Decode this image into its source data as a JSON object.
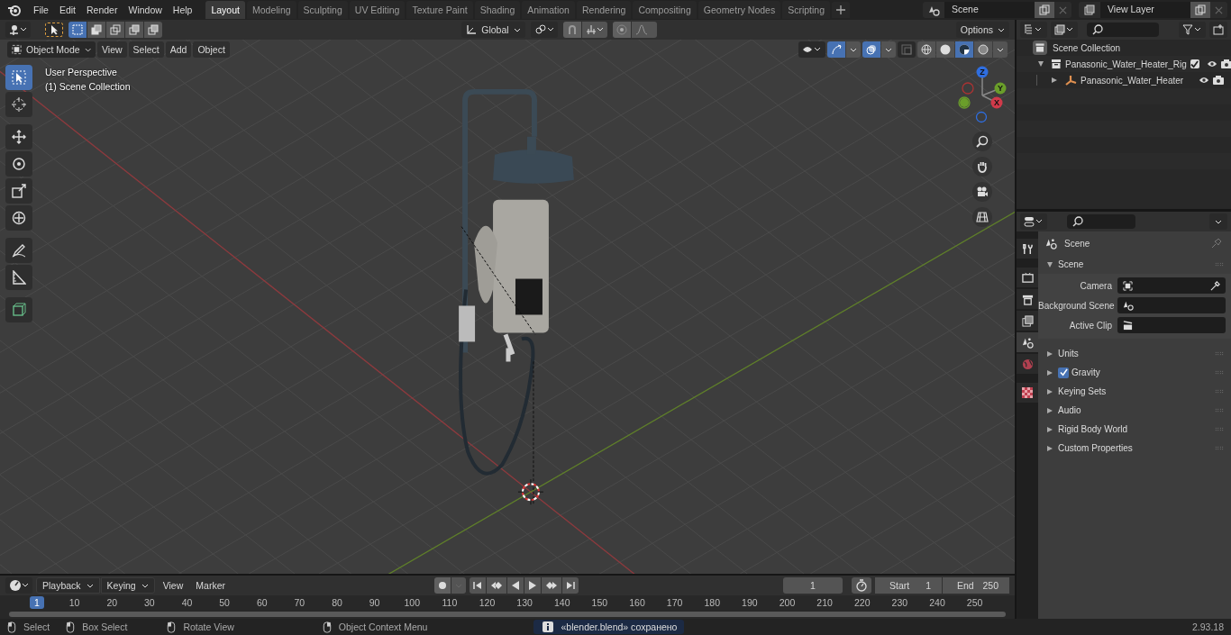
{
  "menu": [
    "File",
    "Edit",
    "Render",
    "Window",
    "Help"
  ],
  "workspaces": [
    {
      "label": "Layout",
      "selected": true
    },
    {
      "label": "Modeling",
      "selected": false
    },
    {
      "label": "Sculpting",
      "selected": false
    },
    {
      "label": "UV Editing",
      "selected": false
    },
    {
      "label": "Texture Paint",
      "selected": false
    },
    {
      "label": "Shading",
      "selected": false
    },
    {
      "label": "Animation",
      "selected": false
    },
    {
      "label": "Rendering",
      "selected": false
    },
    {
      "label": "Compositing",
      "selected": false
    },
    {
      "label": "Geometry Nodes",
      "selected": false
    },
    {
      "label": "Scripting",
      "selected": false
    }
  ],
  "scene_field": "Scene",
  "view_layer_field": "View Layer",
  "viewport": {
    "select_modes": [
      {
        "selected": true
      },
      {
        "selected": false
      },
      {
        "selected": false
      },
      {
        "selected": false
      },
      {
        "selected": false
      }
    ],
    "transform_orientation": "Global",
    "options": "Options",
    "mode": "Object Mode",
    "menus": [
      "View",
      "Select",
      "Add",
      "Object"
    ],
    "shading": [
      {
        "kind": "wireframe",
        "selected": false
      },
      {
        "kind": "solid",
        "selected": false
      },
      {
        "kind": "material",
        "selected": true
      },
      {
        "kind": "rendered",
        "selected": false
      }
    ],
    "overlay_text": [
      "User Perspective",
      "(1) Scene Collection"
    ],
    "tools": [
      {
        "kind": "select",
        "selected": true
      },
      {
        "kind": "cursor",
        "selected": false
      },
      {
        "kind": "move",
        "selected": false
      },
      {
        "kind": "rotate",
        "selected": false
      },
      {
        "kind": "scale",
        "selected": false
      },
      {
        "kind": "transform",
        "selected": false
      },
      {
        "kind": "annotate",
        "selected": false
      },
      {
        "kind": "measure",
        "selected": false
      },
      {
        "kind": "add_cube",
        "selected": false
      }
    ],
    "gizmo": [
      "Z",
      "Y",
      "X"
    ]
  },
  "outliner": {
    "root": "Scene Collection",
    "items": [
      {
        "label": "Panasonic_Water_Heater_Rig",
        "expanded": true,
        "checked": true,
        "children": [
          {
            "label": "Panasonic_Water_Heater",
            "expanded": false
          }
        ]
      }
    ]
  },
  "properties": {
    "tabs": [
      {
        "kind": "tool",
        "selected": false
      },
      {
        "kind": "render",
        "selected": false
      },
      {
        "kind": "output",
        "selected": false
      },
      {
        "kind": "view_layer",
        "selected": false
      },
      {
        "kind": "scene",
        "selected": true
      },
      {
        "kind": "world",
        "selected": false
      },
      {
        "kind": "texture",
        "selected": false
      }
    ],
    "context": "Scene",
    "section": {
      "title": "Scene",
      "expanded": true,
      "fields": [
        {
          "label": "Camera",
          "kind": "camera"
        },
        {
          "label": "Background Scene",
          "kind": "scene"
        },
        {
          "label": "Active Clip",
          "kind": "clip"
        }
      ]
    },
    "panels": [
      {
        "label": "Units",
        "kind": "plain",
        "expanded": false
      },
      {
        "label": "Gravity",
        "kind": "checkbox",
        "checked": true,
        "expanded": false
      },
      {
        "label": "Keying Sets",
        "kind": "plain",
        "expanded": false
      },
      {
        "label": "Audio",
        "kind": "plain",
        "expanded": false
      },
      {
        "label": "Rigid Body World",
        "kind": "plain",
        "expanded": false
      },
      {
        "label": "Custom Properties",
        "kind": "plain",
        "expanded": false
      }
    ]
  },
  "timeline": {
    "menus": [
      "Playback",
      "Keying",
      "View",
      "Marker"
    ],
    "current_frame": "1",
    "start_label": "Start",
    "start": "1",
    "end_label": "End",
    "end": "250",
    "ruler": [
      "1",
      "10",
      "20",
      "30",
      "40",
      "50",
      "60",
      "70",
      "80",
      "90",
      "100",
      "110",
      "120",
      "130",
      "140",
      "150",
      "160",
      "170",
      "180",
      "190",
      "200",
      "210",
      "220",
      "230",
      "240",
      "250"
    ]
  },
  "status_bar": {
    "hints": [
      "Select",
      "Box Select",
      "Rotate View",
      "Object Context Menu"
    ],
    "message": "«blender.blend» сохранено",
    "version": "2.93.18"
  }
}
